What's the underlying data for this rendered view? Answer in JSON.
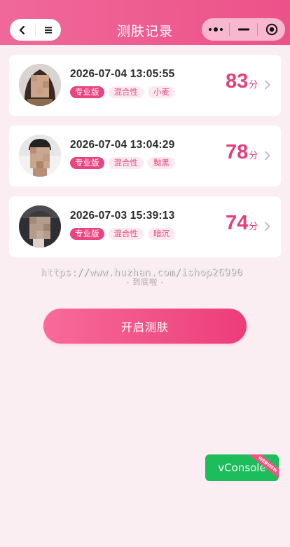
{
  "header": {
    "title": "测肤记录",
    "back_icon": "chevron-left-icon",
    "menu_icon": "hamburger-icon",
    "capsule": {
      "more_icon": "more-dots-icon",
      "minimize_icon": "minimize-icon",
      "close_icon": "record-circle-icon"
    }
  },
  "records": [
    {
      "datetime": "2026-07-04 13:05:55",
      "tags": [
        "专业版",
        "混合性",
        "小麦"
      ],
      "score": "83",
      "unit": "分"
    },
    {
      "datetime": "2026-07-04 13:04:29",
      "tags": [
        "专业版",
        "混合性",
        "黝黑"
      ],
      "score": "78",
      "unit": "分"
    },
    {
      "datetime": "2026-07-03 15:39:13",
      "tags": [
        "专业版",
        "混合性",
        "暗沉"
      ],
      "score": "74",
      "unit": "分"
    }
  ],
  "list_end_text": "- 到底啦 -",
  "watermark": "https://www.huzhan.com/ishop26990",
  "start_button_label": "开启测肤",
  "vconsole": {
    "label": "vConsole",
    "ribbon": "WEBVIEW"
  },
  "colors": {
    "accent": "#e94480",
    "header": "#ee5b8e",
    "background": "#fbeef3",
    "vconsole": "#1ebd5c"
  }
}
